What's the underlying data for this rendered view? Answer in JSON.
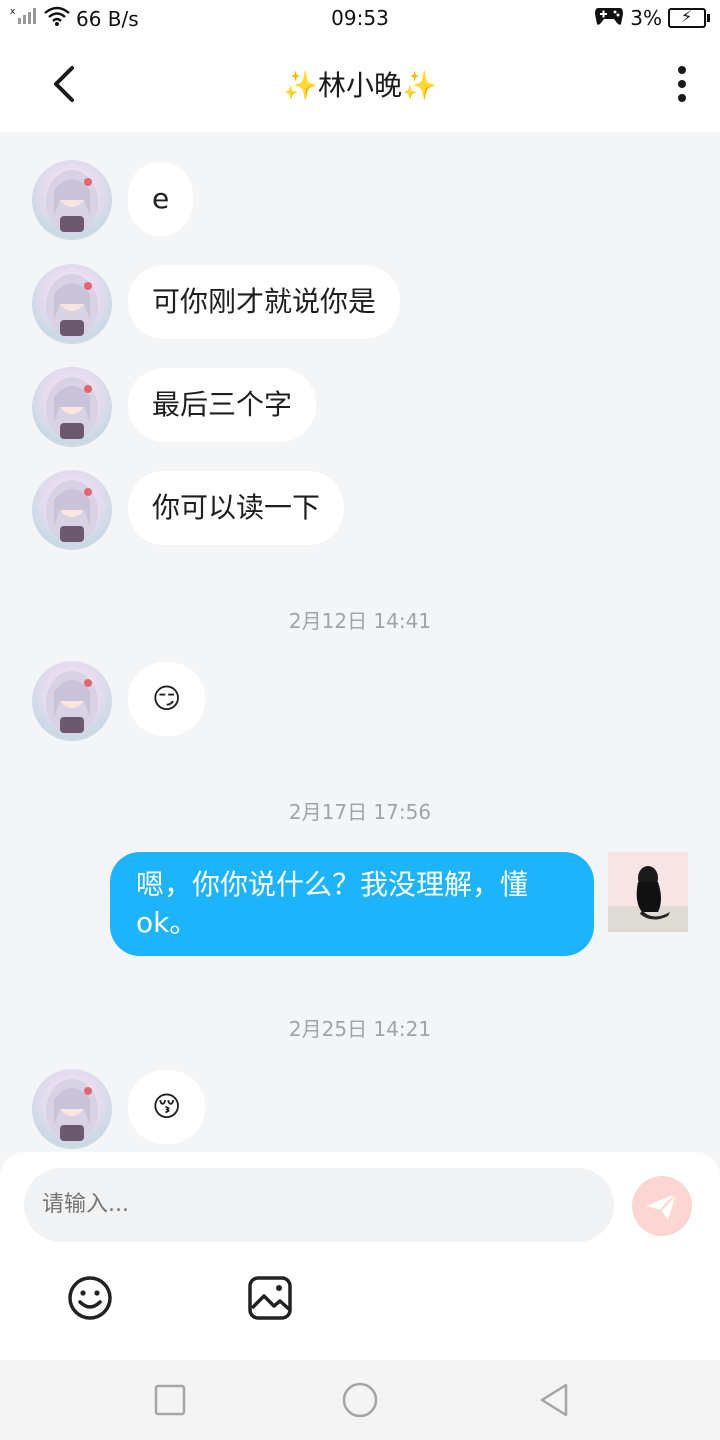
{
  "status_bar": {
    "net_speed": "66 B/s",
    "time": "09:53",
    "battery": "3%"
  },
  "header": {
    "title": "✨林小晚✨"
  },
  "messages": [
    {
      "text": "e"
    },
    {
      "text": "可你刚才就说你是"
    },
    {
      "text": "最后三个字"
    },
    {
      "text": "你可以读一下"
    },
    {
      "timestamp": "2月12日 14:41"
    },
    {
      "text": "😏"
    },
    {
      "timestamp": "2月17日 17:56"
    },
    {
      "text": "嗯，你你说什么？我没理解，懂ok。"
    },
    {
      "timestamp": "2月25日 14:21"
    },
    {
      "text": "😚"
    }
  ],
  "input": {
    "placeholder": "请输入..."
  },
  "icons": {
    "back": "chevron-left-icon",
    "more": "more-vertical-icon",
    "send": "send-icon",
    "emoji": "smiley-icon",
    "image": "image-icon",
    "nav_recents": "square-icon",
    "nav_home": "circle-icon",
    "nav_back": "triangle-back-icon"
  },
  "colors": {
    "outgoing_bubble": "#1eb4fb",
    "send_button": "#fbd6d2",
    "background": "#f4f5f7"
  }
}
